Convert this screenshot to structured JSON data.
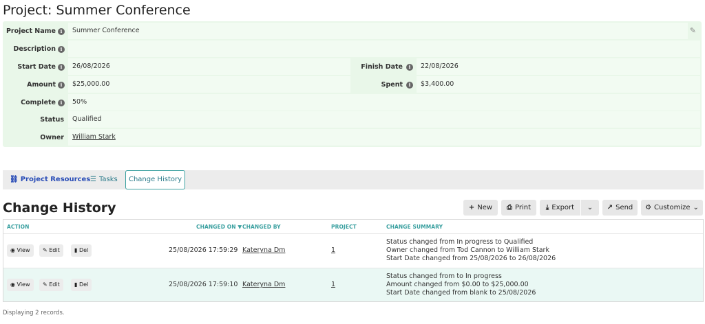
{
  "page": {
    "title": "Project: Summer Conference"
  },
  "form": {
    "project_name": {
      "label": "Project Name",
      "value": "Summer Conference"
    },
    "description": {
      "label": "Description",
      "value": ""
    },
    "start_date": {
      "label": "Start Date",
      "value": "26/08/2026"
    },
    "finish_date": {
      "label": "Finish Date",
      "value": "22/08/2026"
    },
    "amount": {
      "label": "Amount",
      "value": "$25,000.00"
    },
    "spent": {
      "label": "Spent",
      "value": "$3,400.00"
    },
    "complete": {
      "label": "Complete",
      "value": "50%"
    },
    "status": {
      "label": "Status",
      "value": "Qualified"
    },
    "owner": {
      "label": "Owner",
      "value": "William Stark"
    }
  },
  "tabs": {
    "resources": "Project Resources",
    "tasks": "Tasks",
    "history": "Change History"
  },
  "section": {
    "title": "Change History"
  },
  "toolbar": {
    "new": "New",
    "print": "Print",
    "export": "Export",
    "send": "Send",
    "customize": "Customize"
  },
  "grid": {
    "headers": {
      "action": "ACTION",
      "changed_on": "CHANGED ON",
      "changed_by": "CHANGED BY",
      "project": "PROJECT",
      "summary": "CHANGE SUMMARY"
    },
    "actions": {
      "view": "View",
      "edit": "Edit",
      "del": "Del"
    },
    "rows": [
      {
        "changed_on": "25/08/2026 17:59:29",
        "changed_by": "Kateryna Dm",
        "project": "1",
        "summary": [
          "Status changed from In progress to Qualified",
          "Owner changed from Tod Cannon to William Stark",
          "Start Date changed from 25/08/2026 to 26/08/2026"
        ]
      },
      {
        "changed_on": "25/08/2026 17:59:10",
        "changed_by": "Kateryna Dm",
        "project": "1",
        "summary": [
          "Status changed from to In progress",
          "Amount changed from $0.00 to $25,000.00",
          "Start Date changed from blank to 25/08/2026"
        ]
      }
    ]
  },
  "footer": {
    "text": "Displaying 2 records."
  },
  "colors": {
    "accent": "#3aa0a0",
    "form_bg": "#e9f7e9",
    "link": "#2a4db7"
  }
}
